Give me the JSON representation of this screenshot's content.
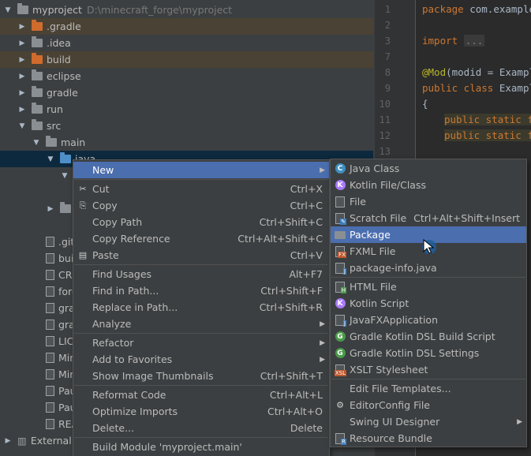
{
  "project": {
    "name": "myproject",
    "path": "D:\\minecraft_forge\\myproject"
  },
  "tree": [
    {
      "label": "myproject",
      "indent": 0,
      "arrow": "down",
      "icon": "gray",
      "path": true
    },
    {
      "label": ".gradle",
      "indent": 1,
      "arrow": "right",
      "icon": "orange",
      "excluded": true
    },
    {
      "label": ".idea",
      "indent": 1,
      "arrow": "right",
      "icon": "gray"
    },
    {
      "label": "build",
      "indent": 1,
      "arrow": "right",
      "icon": "orange",
      "excluded": true
    },
    {
      "label": "eclipse",
      "indent": 1,
      "arrow": "right",
      "icon": "gray"
    },
    {
      "label": "gradle",
      "indent": 1,
      "arrow": "right",
      "icon": "gray"
    },
    {
      "label": "run",
      "indent": 1,
      "arrow": "right",
      "icon": "gray"
    },
    {
      "label": "src",
      "indent": 1,
      "arrow": "down",
      "icon": "gray"
    },
    {
      "label": "main",
      "indent": 2,
      "arrow": "down",
      "icon": "gray"
    },
    {
      "label": "java",
      "indent": 3,
      "arrow": "down",
      "icon": "blue",
      "selected": true
    },
    {
      "label": "",
      "indent": 4,
      "arrow": "down",
      "icon": "none"
    },
    {
      "label": "",
      "indent": 4,
      "arrow": "none",
      "icon": "none"
    },
    {
      "label": "",
      "indent": 3,
      "arrow": "right",
      "icon": "gray"
    },
    {
      "label": "",
      "indent": 4,
      "arrow": "none",
      "icon": "none"
    },
    {
      "label": ".gitign",
      "indent": 2,
      "arrow": "none",
      "icon": "file"
    },
    {
      "label": "build.g",
      "indent": 2,
      "arrow": "none",
      "icon": "file"
    },
    {
      "label": "CREDI",
      "indent": 2,
      "arrow": "none",
      "icon": "file"
    },
    {
      "label": "forge-",
      "indent": 2,
      "arrow": "none",
      "icon": "file"
    },
    {
      "label": "gradle",
      "indent": 2,
      "arrow": "none",
      "icon": "file"
    },
    {
      "label": "gradle",
      "indent": 2,
      "arrow": "none",
      "icon": "file"
    },
    {
      "label": "LICEN",
      "indent": 2,
      "arrow": "none",
      "icon": "file"
    },
    {
      "label": "Minec",
      "indent": 2,
      "arrow": "none",
      "icon": "file"
    },
    {
      "label": "Minec",
      "indent": 2,
      "arrow": "none",
      "icon": "file"
    },
    {
      "label": "Paulsc",
      "indent": 2,
      "arrow": "none",
      "icon": "file"
    },
    {
      "label": "Paulsc",
      "indent": 2,
      "arrow": "none",
      "icon": "file"
    },
    {
      "label": "READI",
      "indent": 2,
      "arrow": "none",
      "icon": "file"
    },
    {
      "label": "External L",
      "indent": 0,
      "arrow": "right",
      "icon": "lib"
    }
  ],
  "editor": {
    "line_numbers": [
      "1",
      "2",
      "3",
      "7",
      "8",
      "9",
      "10",
      "11",
      "12",
      "13"
    ],
    "package_kw": "package",
    "package_name": " com.example.",
    "import_kw": "import",
    "import_fold": "...",
    "mod_ann": "@Mod",
    "mod_args": "(modid = Example",
    "public_kw": "public class",
    "class_name": " Example",
    "brace": "{",
    "field1_kw": "public static fi",
    "field2_kw": "public static fi"
  },
  "context_menu": [
    {
      "label": "New",
      "shortcut": "",
      "submenu": true,
      "active": true,
      "icon": ""
    },
    {
      "label": "Cut",
      "shortcut": "Ctrl+X",
      "icon": "✂"
    },
    {
      "label": "Copy",
      "shortcut": "Ctrl+C",
      "icon": "⎘"
    },
    {
      "label": "Copy Path",
      "shortcut": "Ctrl+Shift+C",
      "icon": ""
    },
    {
      "label": "Copy Reference",
      "shortcut": "Ctrl+Alt+Shift+C",
      "icon": ""
    },
    {
      "label": "Paste",
      "shortcut": "Ctrl+V",
      "icon": "▤"
    },
    {
      "label": "Find Usages",
      "shortcut": "Alt+F7",
      "icon": ""
    },
    {
      "label": "Find in Path...",
      "shortcut": "Ctrl+Shift+F",
      "icon": ""
    },
    {
      "label": "Replace in Path...",
      "shortcut": "Ctrl+Shift+R",
      "icon": ""
    },
    {
      "label": "Analyze",
      "shortcut": "",
      "submenu": true,
      "icon": ""
    },
    {
      "label": "Refactor",
      "shortcut": "",
      "submenu": true,
      "icon": ""
    },
    {
      "label": "Add to Favorites",
      "shortcut": "",
      "submenu": true,
      "icon": ""
    },
    {
      "label": "Show Image Thumbnails",
      "shortcut": "Ctrl+Shift+T",
      "icon": ""
    },
    {
      "label": "Reformat Code",
      "shortcut": "Ctrl+Alt+L",
      "icon": ""
    },
    {
      "label": "Optimize Imports",
      "shortcut": "Ctrl+Alt+O",
      "icon": ""
    },
    {
      "label": "Delete...",
      "shortcut": "Delete",
      "icon": ""
    },
    {
      "label": "Build Module 'myproject.main'",
      "shortcut": "",
      "icon": ""
    }
  ],
  "new_submenu": [
    {
      "label": "Java Class",
      "shortcut": "",
      "icon": "C",
      "color": "#3d8fbf"
    },
    {
      "label": "Kotlin File/Class",
      "shortcut": "",
      "icon": "K",
      "color": "#a97bff"
    },
    {
      "label": "File",
      "shortcut": "",
      "icon": "file"
    },
    {
      "label": "Scratch File",
      "shortcut": "Ctrl+Alt+Shift+Insert",
      "icon": "scratch"
    },
    {
      "label": "Package",
      "shortcut": "",
      "icon": "pkg",
      "active": true
    },
    {
      "label": "FXML File",
      "shortcut": "",
      "icon": "fx"
    },
    {
      "label": "package-info.java",
      "shortcut": "",
      "icon": "J"
    },
    {
      "label": "HTML File",
      "shortcut": "",
      "icon": "H"
    },
    {
      "label": "Kotlin Script",
      "shortcut": "",
      "icon": "K",
      "color": "#a97bff"
    },
    {
      "label": "JavaFXApplication",
      "shortcut": "",
      "icon": "J"
    },
    {
      "label": "Gradle Kotlin DSL Build Script",
      "shortcut": "",
      "icon": "G",
      "color": "#4a9a4a"
    },
    {
      "label": "Gradle Kotlin DSL Settings",
      "shortcut": "",
      "icon": "G",
      "color": "#4a9a4a"
    },
    {
      "label": "XSLT Stylesheet",
      "shortcut": "",
      "icon": "XSL"
    },
    {
      "label": "Edit File Templates...",
      "shortcut": "",
      "icon": ""
    },
    {
      "label": "EditorConfig File",
      "shortcut": "",
      "icon": "gear"
    },
    {
      "label": "Swing UI Designer",
      "shortcut": "",
      "icon": "",
      "submenu": true
    },
    {
      "label": "Resource Bundle",
      "shortcut": "",
      "icon": "rb"
    }
  ]
}
